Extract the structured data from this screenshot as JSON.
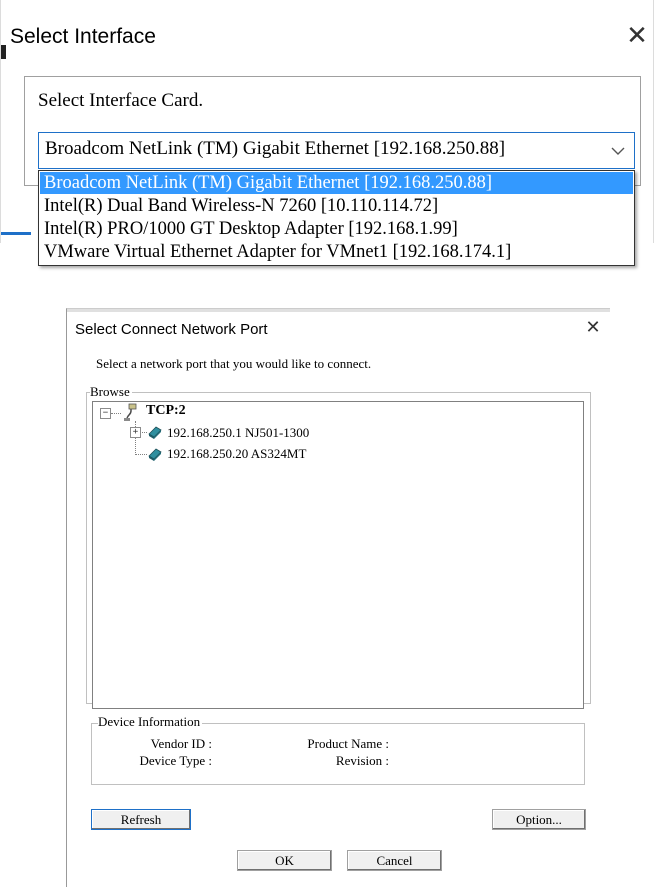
{
  "interface_dialog": {
    "title": "Select Interface",
    "close_glyph": "✕",
    "label": "Select Interface Card.",
    "selected_value": "Broadcom NetLink (TM) Gigabit Ethernet [192.168.250.88]",
    "options": [
      "Broadcom NetLink (TM) Gigabit Ethernet [192.168.250.88]",
      "Intel(R) Dual Band Wireless-N 7260 [10.110.114.72]",
      "Intel(R) PRO/1000 GT Desktop Adapter [192.168.1.99]",
      "VMware Virtual Ethernet Adapter for VMnet1 [192.168.174.1]"
    ],
    "highlighted_index": 0,
    "accent_color": "#3399ff"
  },
  "port_dialog": {
    "title": "Select Connect Network Port",
    "close_glyph": "✕",
    "instruction": "Select a network port that you would like to connect.",
    "browse_label": "Browse",
    "tree": {
      "root": {
        "label": "TCP:2",
        "icon": "network-port-icon",
        "expanded": true
      },
      "children": [
        {
          "label": "192.168.250.1 NJ501-1300",
          "icon": "device-icon",
          "has_children": true
        },
        {
          "label": "192.168.250.20 AS324MT",
          "icon": "device-icon",
          "has_children": false
        }
      ]
    },
    "device_info": {
      "label": "Device Information",
      "vendor_id_label": "Vendor ID :",
      "device_type_label": "Device Type :",
      "product_name_label": "Product Name :",
      "revision_label": "Revision :"
    },
    "buttons": {
      "refresh": "Refresh",
      "option": "Option...",
      "ok": "OK",
      "cancel": "Cancel"
    }
  }
}
